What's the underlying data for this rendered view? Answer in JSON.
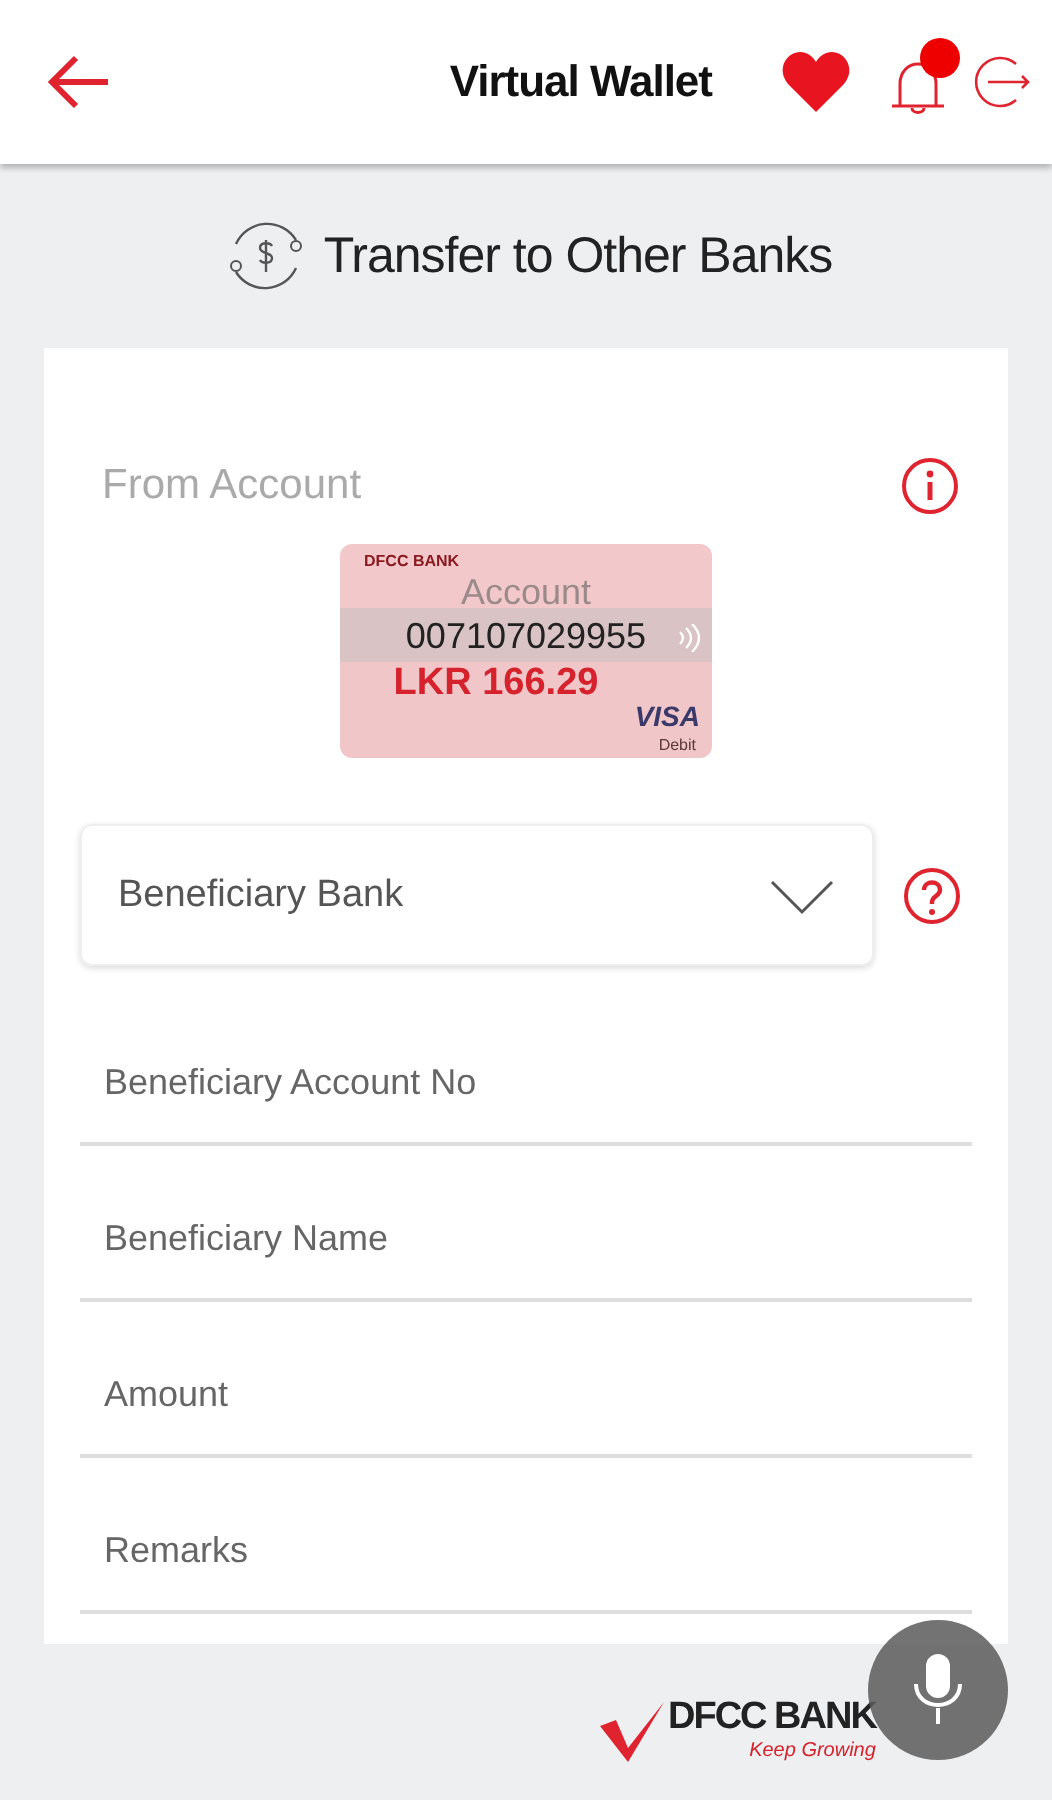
{
  "header": {
    "title": "Virtual Wallet",
    "notification_badge": true
  },
  "page_title": "Transfer to Other Banks",
  "from_account": {
    "label": "From Account",
    "card": {
      "brand": "DFCC BANK",
      "label": "Account",
      "number": "007107029955",
      "balance": "LKR 166.29",
      "network": "VISA",
      "type": "Debit"
    }
  },
  "beneficiary_bank": {
    "placeholder": "Beneficiary Bank"
  },
  "fields": [
    {
      "placeholder": "Beneficiary Account No"
    },
    {
      "placeholder": "Beneficiary Name"
    },
    {
      "placeholder": "Amount"
    },
    {
      "placeholder": "Remarks"
    }
  ],
  "footer": {
    "logo": "DFCC BANK",
    "tagline": "Keep Growing"
  }
}
